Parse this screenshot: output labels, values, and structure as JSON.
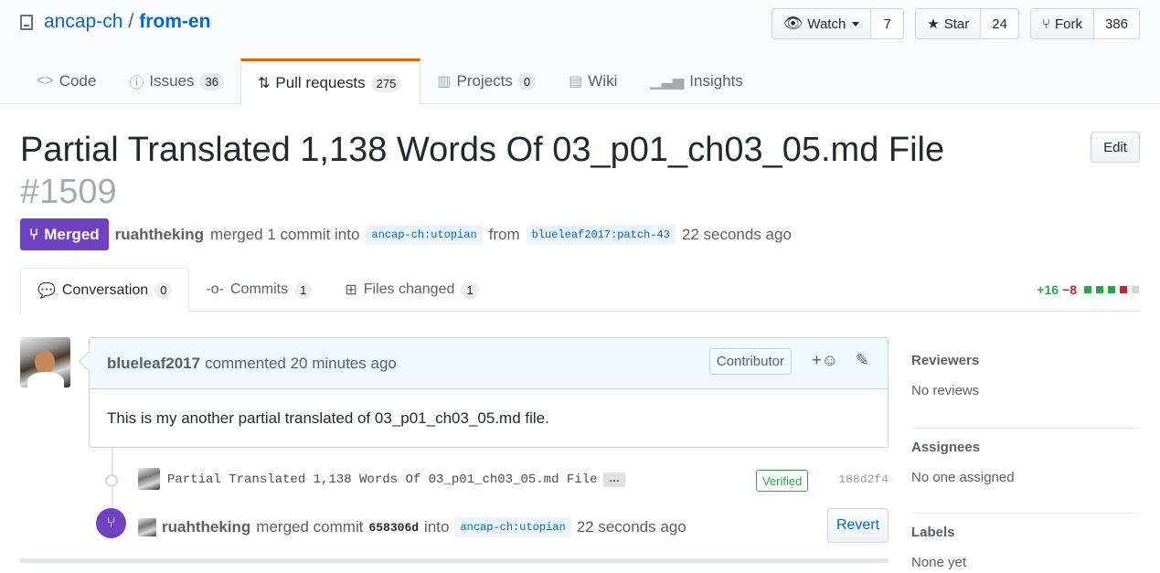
{
  "repo": {
    "owner": "ancap-ch",
    "separator": "/",
    "name": "from-en"
  },
  "actions": {
    "watch": {
      "label": "Watch",
      "count": "7"
    },
    "star": {
      "label": "Star",
      "count": "24"
    },
    "fork": {
      "label": "Fork",
      "count": "386"
    }
  },
  "reponav": [
    {
      "label": "Code",
      "count": ""
    },
    {
      "label": "Issues",
      "count": "36"
    },
    {
      "label": "Pull requests",
      "count": "275"
    },
    {
      "label": "Projects",
      "count": "0"
    },
    {
      "label": "Wiki",
      "count": ""
    },
    {
      "label": "Insights",
      "count": ""
    }
  ],
  "pr": {
    "title": "Partial Translated 1,138 Words Of 03_p01_ch03_05.md File",
    "number": "#1509",
    "edit_label": "Edit",
    "state": "Merged",
    "merger": "ruahtheking",
    "merged_text": "merged 1 commit into",
    "base_branch": "ancap-ch:utopian",
    "from_text": "from",
    "head_branch": "blueleaf2017:patch-43",
    "time": "22 seconds ago"
  },
  "tabs": [
    {
      "label": "Conversation",
      "count": "0"
    },
    {
      "label": "Commits",
      "count": "1"
    },
    {
      "label": "Files changed",
      "count": "1"
    }
  ],
  "diffstat": {
    "additions": "+16",
    "deletions": "−8"
  },
  "comment": {
    "author": "blueleaf2017",
    "action": "commented 20 minutes ago",
    "role": "Contributor",
    "body": "This is my another partial translated of 03_p01_ch03_05.md file."
  },
  "commit": {
    "message": "Partial Translated 1,138 Words Of 03_p01_ch03_05.md File",
    "ellipsis": "…",
    "verified": "Verified",
    "sha": "188d2f4"
  },
  "merge_event": {
    "user": "ruahtheking",
    "text1": "merged commit",
    "sha": "658306d",
    "text2": "into",
    "branch": "ancap-ch:utopian",
    "time": "22 seconds ago",
    "revert_label": "Revert"
  },
  "sidebar": {
    "reviewers": {
      "title": "Reviewers",
      "value": "No reviews"
    },
    "assignees": {
      "title": "Assignees",
      "value": "No one assigned"
    },
    "labels": {
      "title": "Labels",
      "value": "None yet"
    }
  },
  "colors": {
    "merged": "#6f42c1",
    "link": "#0366d6",
    "add": "#28a745",
    "del": "#cb2431",
    "accent_tab": "#e36209"
  }
}
